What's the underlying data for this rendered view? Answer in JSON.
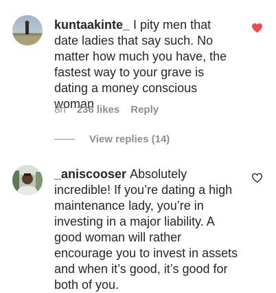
{
  "comments": [
    {
      "username": "kuntaakinte_",
      "text": "I pity men that date ladies that say such. No matter how much you have, the fastest way to your grave is dating a money conscious woman",
      "time": "8h",
      "likes": "236 likes",
      "reply_label": "Reply",
      "liked": true,
      "heart_color": "#ed4956",
      "view_replies": "View replies (14)"
    },
    {
      "username": "_aniscooser",
      "text": "Absolutely incredible! If you’re dating a high maintenance lady, you’re in investing in a major liability. A good woman will rather encourage you to invest in assets and when it’s good, it’s good for both of you.",
      "liked": false,
      "heart_color": "#262626"
    }
  ]
}
